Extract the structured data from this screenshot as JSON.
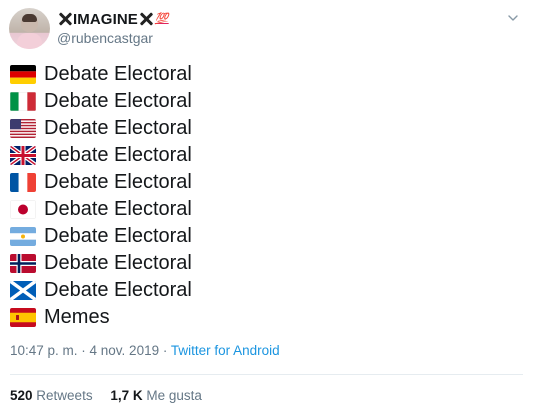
{
  "tweet": {
    "display_name": "IMAGINE",
    "emoji_badge": "💯",
    "handle": "@rubencastgar",
    "lines": [
      {
        "flag": "flag-germany",
        "text": "Debate Electoral"
      },
      {
        "flag": "flag-italy",
        "text": "Debate Electoral"
      },
      {
        "flag": "flag-usa",
        "text": "Debate Electoral"
      },
      {
        "flag": "flag-uk",
        "text": "Debate Electoral"
      },
      {
        "flag": "flag-france",
        "text": "Debate Electoral"
      },
      {
        "flag": "flag-japan",
        "text": "Debate Electoral"
      },
      {
        "flag": "flag-argentina",
        "text": "Debate Electoral"
      },
      {
        "flag": "flag-norway",
        "text": "Debate Electoral"
      },
      {
        "flag": "flag-scotland",
        "text": "Debate Electoral"
      },
      {
        "flag": "flag-spain",
        "text": "Memes"
      }
    ],
    "timestamp": "10:47 p. m. · 4 nov. 2019",
    "separator": "·",
    "source": "Twitter for Android",
    "retweets_count": "520",
    "retweets_label": "Retweets",
    "likes_count": "1,7 K",
    "likes_label": "Me gusta"
  },
  "icons": {
    "menu": "chevron-down-icon",
    "name_decoration": "cross-mark-icon"
  },
  "colors": {
    "link": "#1b95e0",
    "secondary_text": "#657786",
    "primary_text": "#14171a"
  }
}
